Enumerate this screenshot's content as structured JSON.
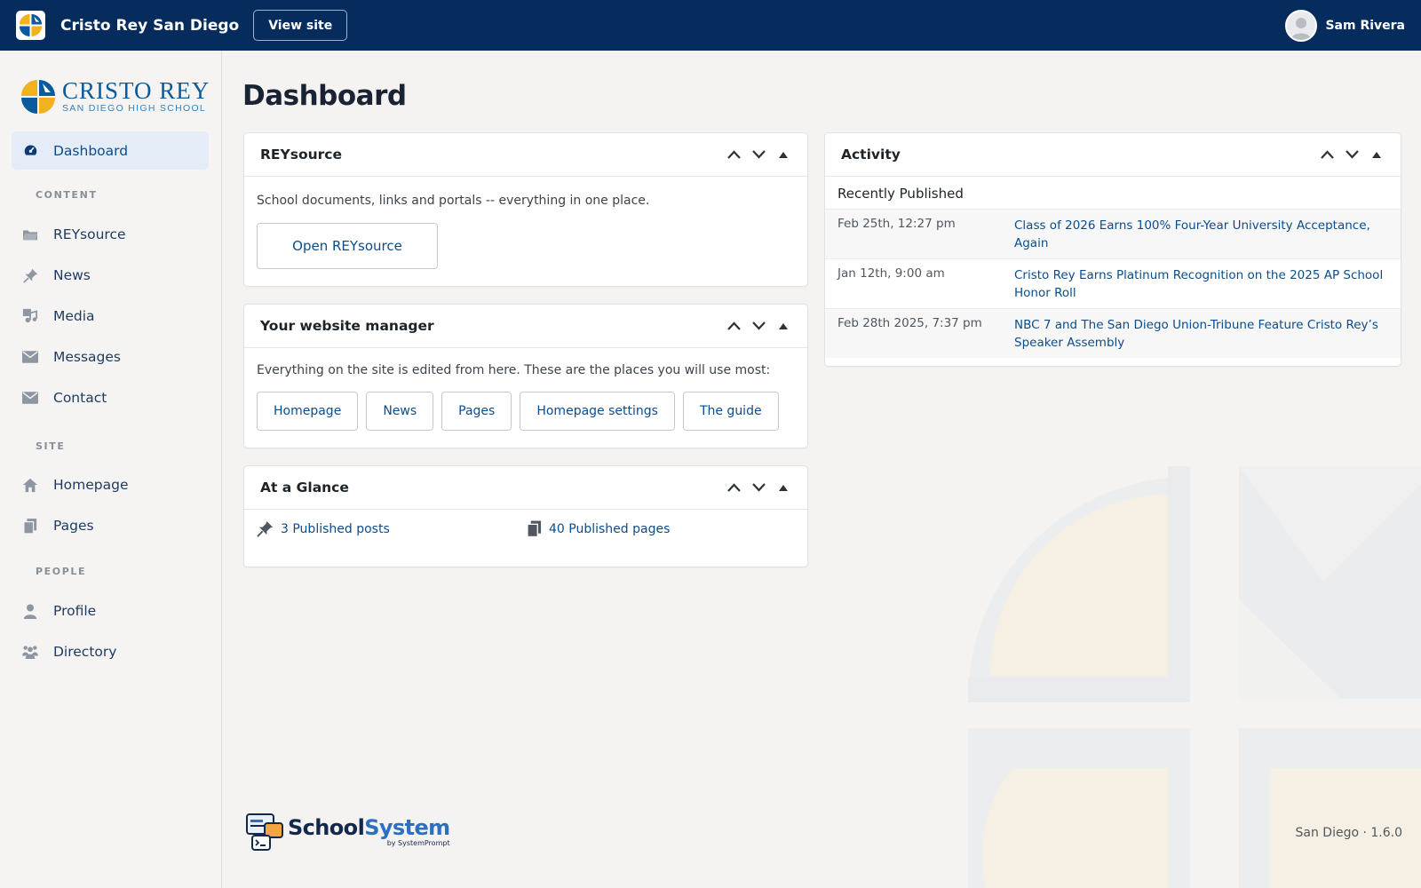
{
  "topbar": {
    "site_name": "Cristo Rey San Diego",
    "view_site_label": "View site",
    "user_name": "Sam Rivera"
  },
  "brand": {
    "title": "CRISTO  REY",
    "subtitle": "SAN DIEGO HIGH SCHOOL"
  },
  "sidebar": {
    "active": {
      "label": "Dashboard",
      "icon": "dashboard-icon"
    },
    "sections": [
      {
        "label": "CONTENT",
        "items": [
          {
            "label": "REYsource",
            "icon": "folder-icon"
          },
          {
            "label": "News",
            "icon": "pin-icon"
          },
          {
            "label": "Media",
            "icon": "media-icon"
          },
          {
            "label": "Messages",
            "icon": "envelope-icon"
          },
          {
            "label": "Contact",
            "icon": "envelope-icon"
          }
        ]
      },
      {
        "label": "SITE",
        "items": [
          {
            "label": "Homepage",
            "icon": "home-icon"
          },
          {
            "label": "Pages",
            "icon": "pages-icon"
          }
        ]
      },
      {
        "label": "PEOPLE",
        "items": [
          {
            "label": "Profile",
            "icon": "person-icon"
          },
          {
            "label": "Directory",
            "icon": "group-icon"
          }
        ]
      }
    ]
  },
  "main": {
    "page_title": "Dashboard",
    "reysource": {
      "title": "REYsource",
      "text": "School documents, links and portals -- everything in one place.",
      "button": "Open REYsource"
    },
    "manager": {
      "title": "Your website manager",
      "text": "Everything on the site is edited from here. These are the places you will use most:",
      "buttons": [
        "Homepage",
        "News",
        "Pages",
        "Homepage settings",
        "The guide"
      ]
    },
    "glance": {
      "title": "At a Glance",
      "posts": "3 Published posts",
      "pages": "40 Published pages"
    },
    "activity": {
      "title": "Activity",
      "subtitle": "Recently Published",
      "rows": [
        {
          "date": "Feb 25th, 12:27 pm",
          "title": "Class of 2026 Earns 100% Four-Year University Acceptance, Again"
        },
        {
          "date": "Jan 12th, 9:00 am",
          "title": "Cristo Rey Earns Platinum Recognition on the 2025 AP School Honor Roll"
        },
        {
          "date": "Feb 28th 2025, 7:37 pm",
          "title": "NBC 7 and The San Diego Union-Tribune Feature Cristo Rey’s Speaker Assembly"
        }
      ]
    }
  },
  "footer": {
    "brand_a": "School",
    "brand_b": "System",
    "by": "by SystemPrompt",
    "version": "San Diego · 1.6.0"
  },
  "colors": {
    "topbar": "#062c5d",
    "link": "#0b4c8c",
    "active_bg": "#e4edf7",
    "logo_gold": "#f2b21f",
    "logo_blue": "#0a5a9c"
  }
}
